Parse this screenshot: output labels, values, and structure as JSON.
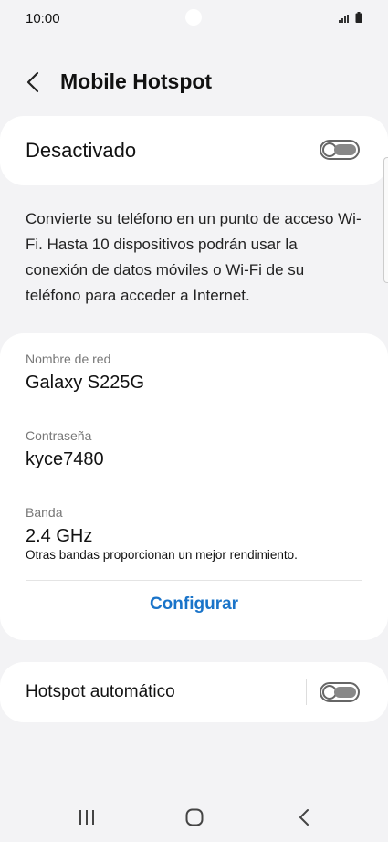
{
  "status": {
    "time": "10:00",
    "icons": [
      "signal-icon",
      "battery-icon"
    ]
  },
  "header": {
    "title": "Mobile Hotspot",
    "back_icon": "chevron-left-icon"
  },
  "main_toggle": {
    "label": "Desactivado",
    "state": "off"
  },
  "description": "Convierte su teléfono en un punto de acceso Wi-Fi. Hasta 10 dispositivos podrán usar la conexión de datos móviles o Wi-Fi de su teléfono para acceder a Internet.",
  "info": {
    "network_name_label": "Nombre de red",
    "network_name_value": "Galaxy S225G",
    "password_label": "Contraseña",
    "password_value": "kyce7480",
    "band_label": "Banda",
    "band_value": "2.4 GHz",
    "band_note": "Otras bandas proporcionan un mejor rendimiento.",
    "configure_label": "Configurar"
  },
  "auto_hotspot": {
    "label": "Hotspot automático",
    "state": "off"
  },
  "nav": {
    "icons": [
      "recent-apps-icon",
      "home-icon",
      "back-icon"
    ]
  },
  "colors": {
    "accent": "#1a74c9",
    "background": "#f3f3f5",
    "card": "#ffffff"
  }
}
